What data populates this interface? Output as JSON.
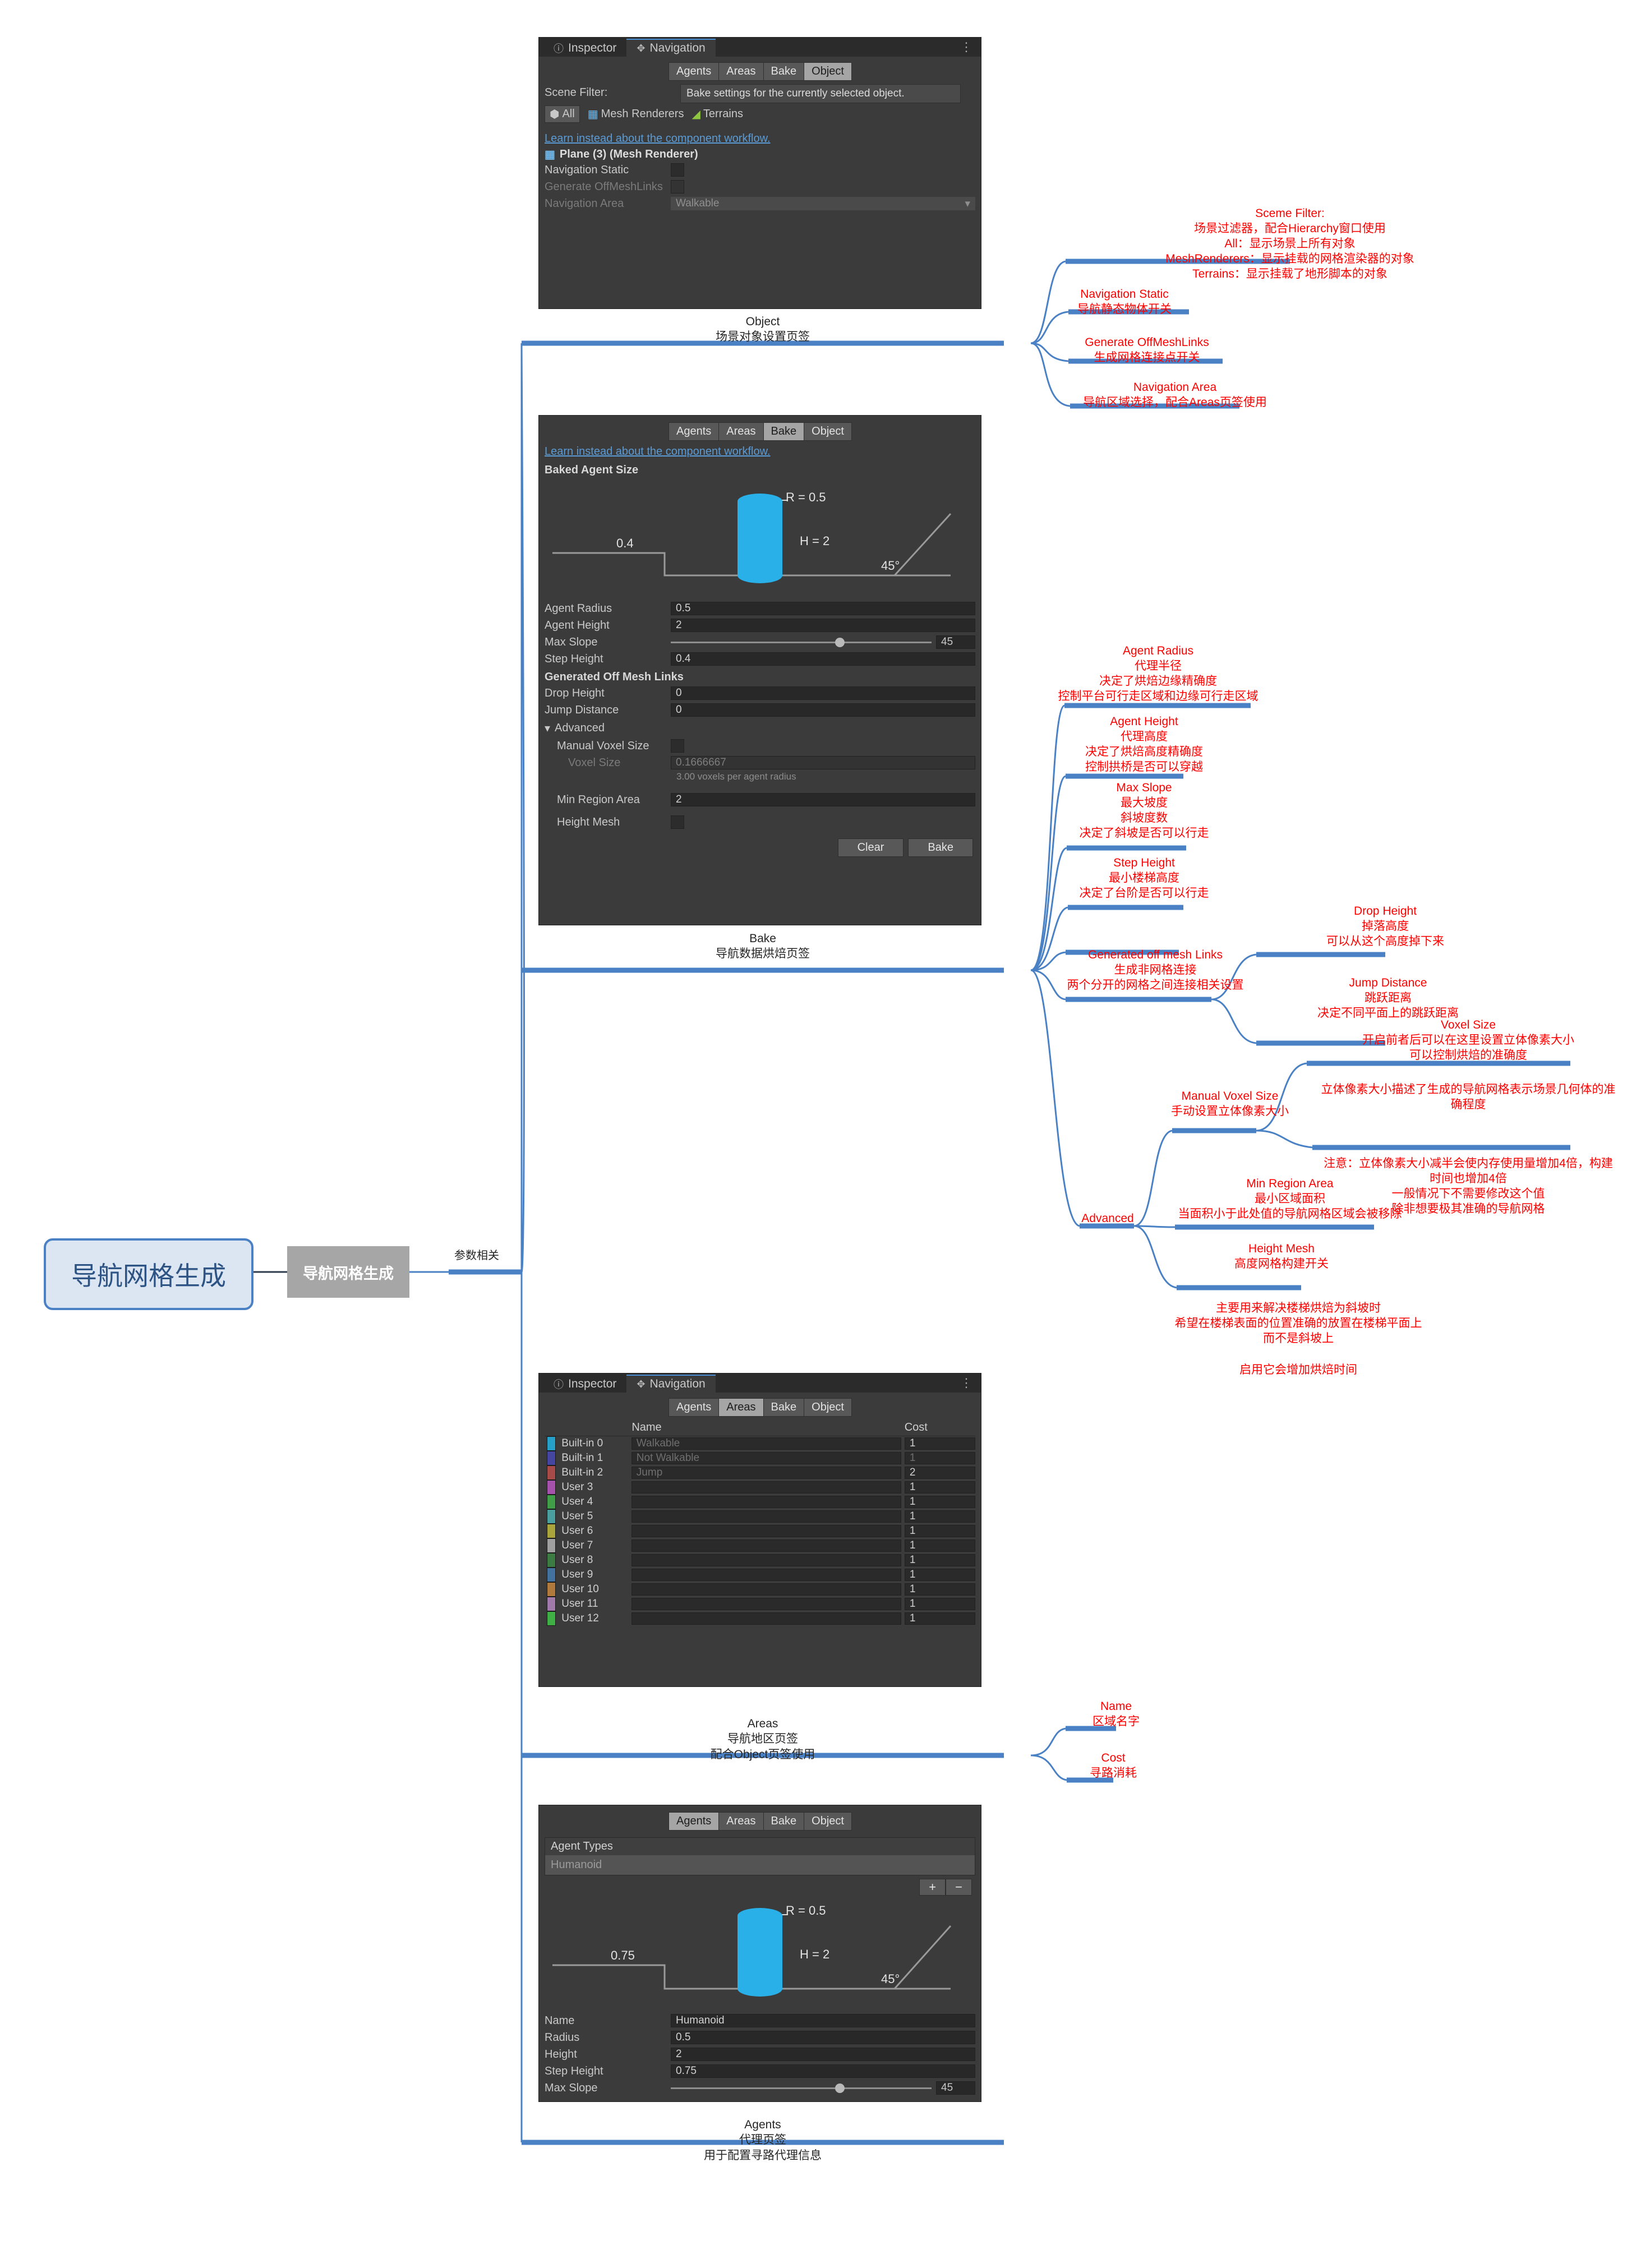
{
  "root": {
    "label": "导航网格生成"
  },
  "branch": {
    "label": "导航网格生成"
  },
  "sub_branch": {
    "label": "参数相关"
  },
  "panels": {
    "object": {
      "window_tabs": [
        {
          "icon": "info-icon",
          "label": "Inspector"
        },
        {
          "icon": "navigation-icon",
          "label": "Navigation"
        }
      ],
      "overflow": "⋮",
      "segments": [
        "Agents",
        "Areas",
        "Bake",
        "Object"
      ],
      "active_segment": "Object",
      "scene_filter_label": "Scene Filter:",
      "tooltip": "Bake settings for the currently selected object.",
      "filters": [
        {
          "icon": "cube-icon",
          "label": "All",
          "active": true
        },
        {
          "icon": "mesh-renderer-icon",
          "label": "Mesh Renderers",
          "active": false
        },
        {
          "icon": "terrain-icon",
          "label": "Terrains",
          "active": false
        }
      ],
      "learn_link": "Learn instead about the component workflow.",
      "selected_object": "Plane (3) (Mesh Renderer)",
      "rows": [
        {
          "label": "Navigation Static",
          "type": "checkbox",
          "value": "",
          "dim": false
        },
        {
          "label": "Generate OffMeshLinks",
          "type": "checkbox",
          "value": "",
          "dim": true
        },
        {
          "label": "Navigation Area",
          "type": "dropdown",
          "value": "Walkable",
          "dim": true
        }
      ],
      "caption": "Object\n场景对象设置页签"
    },
    "bake": {
      "segments": [
        "Agents",
        "Areas",
        "Bake",
        "Object"
      ],
      "active_segment": "Bake",
      "learn_link": "Learn instead about the component workflow.",
      "section_title": "Baked Agent Size",
      "diagram": {
        "radius_label": "R = 0.5",
        "height_label": "H = 2",
        "step_label": "0.4",
        "slope_label": "45°"
      },
      "fields": [
        {
          "label": "Agent Radius",
          "value": "0.5",
          "type": "text"
        },
        {
          "label": "Agent Height",
          "value": "2",
          "type": "text"
        },
        {
          "label": "Max Slope",
          "value": "45",
          "type": "slider"
        },
        {
          "label": "Step Height",
          "value": "0.4",
          "type": "text"
        }
      ],
      "offmesh_title": "Generated Off Mesh Links",
      "offmesh_fields": [
        {
          "label": "Drop Height",
          "value": "0",
          "type": "text"
        },
        {
          "label": "Jump Distance",
          "value": "0",
          "type": "text"
        }
      ],
      "advanced_title": "Advanced",
      "advanced_fields": [
        {
          "label": "Manual Voxel Size",
          "value": "",
          "type": "checkbox",
          "dim": false
        },
        {
          "label": "Voxel Size",
          "value": "0.1666667",
          "type": "text",
          "dim": true
        },
        {
          "label": "Min Region Area",
          "value": "2",
          "type": "text",
          "dim": false
        },
        {
          "label": "Height Mesh",
          "value": "",
          "type": "checkbox",
          "dim": false
        }
      ],
      "voxel_hint": "3.00 voxels per agent radius",
      "buttons": [
        "Clear",
        "Bake"
      ],
      "caption": "Bake\n导航数据烘焙页签"
    },
    "areas": {
      "window_tabs": [
        {
          "icon": "info-icon",
          "label": "Inspector"
        },
        {
          "icon": "navigation-icon",
          "label": "Navigation"
        }
      ],
      "overflow": "⋮",
      "segments": [
        "Agents",
        "Areas",
        "Bake",
        "Object"
      ],
      "active_segment": "Areas",
      "columns": [
        "Name",
        "Cost"
      ],
      "rows": [
        {
          "id": "Built-in 0",
          "color": "#26a0c8",
          "name": "Walkable",
          "cost": "1",
          "dim_name": true,
          "dim_cost": false
        },
        {
          "id": "Built-in 1",
          "color": "#4546a0",
          "name": "Not Walkable",
          "cost": "1",
          "dim_name": true,
          "dim_cost": true
        },
        {
          "id": "Built-in 2",
          "color": "#a74b49",
          "name": "Jump",
          "cost": "2",
          "dim_name": true,
          "dim_cost": false
        },
        {
          "id": "User 3",
          "color": "#a452ab",
          "name": "",
          "cost": "1",
          "dim_name": false,
          "dim_cost": false
        },
        {
          "id": "User 4",
          "color": "#3f9e47",
          "name": "",
          "cost": "1",
          "dim_name": false,
          "dim_cost": false
        },
        {
          "id": "User 5",
          "color": "#4a9e9e",
          "name": "",
          "cost": "1",
          "dim_name": false,
          "dim_cost": false
        },
        {
          "id": "User 6",
          "color": "#aaa43c",
          "name": "",
          "cost": "1",
          "dim_name": false,
          "dim_cost": false
        },
        {
          "id": "User 7",
          "color": "#a0a0a0",
          "name": "",
          "cost": "1",
          "dim_name": false,
          "dim_cost": false
        },
        {
          "id": "User 8",
          "color": "#3c7b42",
          "name": "",
          "cost": "1",
          "dim_name": false,
          "dim_cost": false
        },
        {
          "id": "User 9",
          "color": "#44729f",
          "name": "",
          "cost": "1",
          "dim_name": false,
          "dim_cost": false
        },
        {
          "id": "User 10",
          "color": "#b07a3c",
          "name": "",
          "cost": "1",
          "dim_name": false,
          "dim_cost": false
        },
        {
          "id": "User 11",
          "color": "#a07aa8",
          "name": "",
          "cost": "1",
          "dim_name": false,
          "dim_cost": false
        },
        {
          "id": "User 12",
          "color": "#3fae44",
          "name": "",
          "cost": "1",
          "dim_name": false,
          "dim_cost": false
        }
      ],
      "caption": "Areas\n导航地区页签\n配合Object页签使用"
    },
    "agents": {
      "segments": [
        "Agents",
        "Areas",
        "Bake",
        "Object"
      ],
      "active_segment": "Agents",
      "list_title": "Agent Types",
      "list_items": [
        "Humanoid"
      ],
      "add_button": "+",
      "remove_button": "−",
      "diagram": {
        "radius_label": "R = 0.5",
        "height_label": "H = 2",
        "step_label": "0.75",
        "slope_label": "45°"
      },
      "fields": [
        {
          "label": "Name",
          "value": "Humanoid",
          "type": "text"
        },
        {
          "label": "Radius",
          "value": "0.5",
          "type": "text"
        },
        {
          "label": "Height",
          "value": "2",
          "type": "text"
        },
        {
          "label": "Step Height",
          "value": "0.75",
          "type": "text"
        },
        {
          "label": "Max Slope",
          "value": "45",
          "type": "slider"
        }
      ],
      "caption": "Agents\n代理页签\n用于配置寻路代理信息"
    }
  },
  "annotations": {
    "scene_filter": "Sceme Filter:\n场景过滤器，配合Hierarchy窗口使用\nAll：显示场景上所有对象\nMeshRenderers：显示挂载的网格渲染器的对象\nTerrains：显示挂载了地形脚本的对象",
    "navigation_static": "Navigation Static\n导航静态物体开关",
    "generate_offmeshlinks": "Generate OffMeshLinks\n生成网格连接点开关",
    "navigation_area": "Navigation Area\n导航区域选择，配合Areas页签使用",
    "agent_radius": "Agent Radius\n代理半径\n决定了烘焙边缘精确度\n控制平台可行走区域和边缘可行走区域",
    "agent_height": "Agent Height\n代理高度\n决定了烘焙高度精确度\n控制拱桥是否可以穿越",
    "max_slope": "Max Slope\n最大坡度\n斜坡度数\n决定了斜坡是否可以行走",
    "step_height": "Step Height\n最小楼梯高度\n决定了台阶是否可以行走",
    "generated_off_mesh_links": "Generated off mesh Links\n生成非网格连接\n两个分开的网格之间连接相关设置",
    "drop_height": "Drop Height\n掉落高度\n可以从这个高度掉下来",
    "jump_distance": "Jump Distance\n跳跃距离\n决定不同平面上的跳跃距离",
    "voxel_size": "Voxel Size\n开启前者后可以在这里设置立体像素大小\n可以控制烘焙的准确度",
    "voxel_size_desc": "立体像素大小描述了生成的导航网格表示场景几何体的准\n确程度",
    "voxel_note": "注意：立体像素大小减半会使内存使用量增加4倍，构建\n时间也增加4倍\n一般情况下不需要修改这个值\n除非想要极其准确的导航网格",
    "manual_voxel_size": "Manual Voxel Size\n手动设置立体像素大小",
    "advanced": "Advanced",
    "min_region_area": "Min Region Area\n最小区域面积\n当面积小于此处值的导航网格区域会被移除",
    "height_mesh": "Height Mesh\n高度网格构建开关",
    "height_mesh_desc": "主要用来解决楼梯烘焙为斜坡时\n希望在楼梯表面的位置准确的放置在楼梯平面上\n而不是斜坡上",
    "height_mesh_note": "启用它会增加烘焙时间",
    "name": "Name\n区域名字",
    "cost": "Cost\n寻路消耗"
  }
}
